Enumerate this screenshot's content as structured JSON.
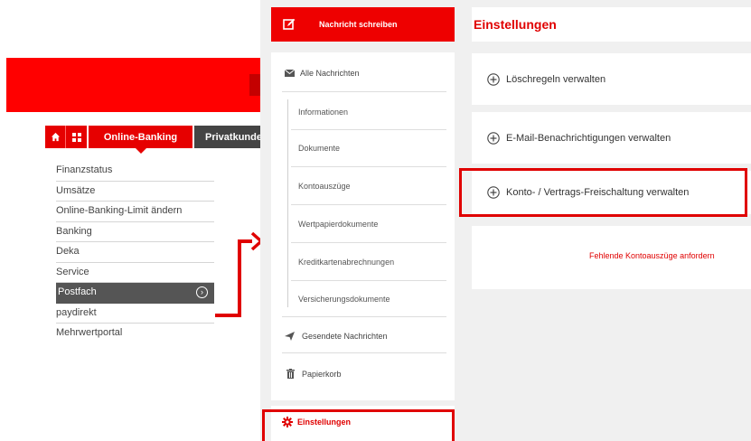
{
  "left_nav": {
    "tabs": {
      "home_icon": "home-icon",
      "grid_icon": "grid-icon",
      "online_banking": "Online-Banking",
      "privatkunden": "Privatkunden"
    },
    "menu_items": [
      {
        "label": "Finanzstatus"
      },
      {
        "label": "Umsätze"
      },
      {
        "label": "Online-Banking-Limit ändern"
      },
      {
        "label": "Banking"
      },
      {
        "label": "Deka"
      },
      {
        "label": "Service"
      },
      {
        "label": "Postfach",
        "active": true
      },
      {
        "label": "paydirekt"
      },
      {
        "label": "Mehrwertportal"
      }
    ]
  },
  "postfach": {
    "write_button": "Nachricht schreiben",
    "all_messages": "Alle Nachrichten",
    "subfolders": [
      "Informationen",
      "Dokumente",
      "Kontoauszüge",
      "Wertpapierdokumente",
      "Kreditkartenabrechnungen",
      "Versicherungsdokumente"
    ],
    "sent": "Gesendete Nachrichten",
    "trash": "Papierkorb",
    "settings": "Einstellungen"
  },
  "settings": {
    "title": "Einstellungen",
    "options": [
      "Löschregeln verwalten",
      "E-Mail-Benachrichtigungen verwalten",
      "Konto- / Vertrags-Freischaltung verwalten"
    ],
    "missing_statements": "Fehlende Kontoauszüge anfordern"
  },
  "colors": {
    "brand_red": "#ee0000",
    "highlight": "#e00000",
    "active_bg": "#555555",
    "panel_bg": "#f0f0f0"
  }
}
